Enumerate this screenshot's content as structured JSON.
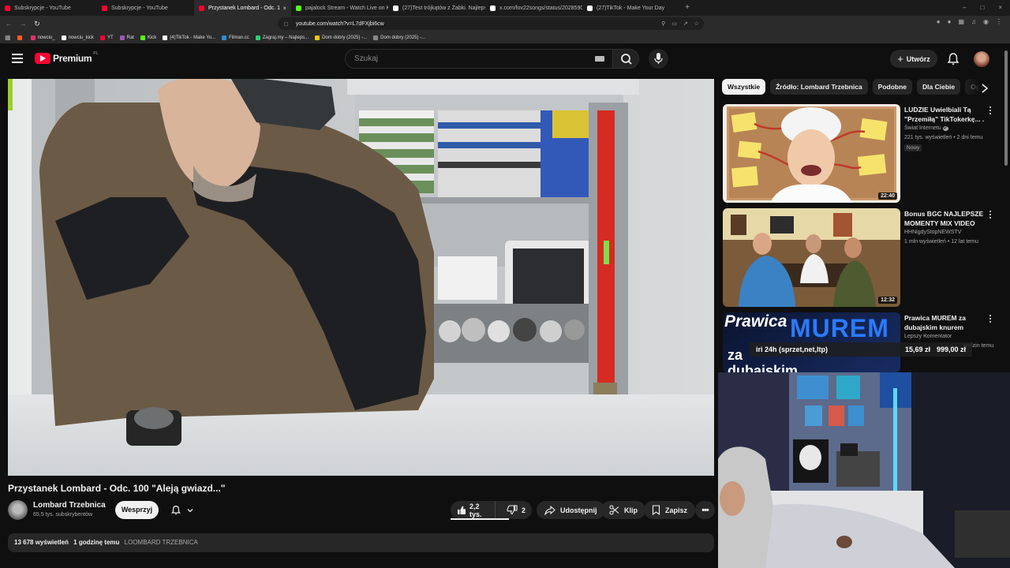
{
  "browser": {
    "tabs": [
      {
        "label": "Subskrypcje - YouTube",
        "color": "#ff0033",
        "active": false
      },
      {
        "label": "Subskrypcje - YouTube",
        "color": "#ff0033",
        "active": false
      },
      {
        "label": "Przystanek Lombard - Odc. 1",
        "color": "#ff0033",
        "active": true
      },
      {
        "label": "pajalock Stream - Watch Live on Kick",
        "color": "#53fc18",
        "active": false
      },
      {
        "label": "(27)Test trójkątów z Żabki. Najlepsz",
        "color": "#ffffff",
        "active": false
      },
      {
        "label": "x.com/fov22songs/status/20285901",
        "color": "#ffffff",
        "active": false
      },
      {
        "label": "(27)TikTok - Make Your Day",
        "color": "#ffffff",
        "active": false
      }
    ],
    "tab_close": "×",
    "new_tab": "+",
    "window_controls": [
      "–",
      "□",
      "×"
    ],
    "url": "youtube.com/watch?v=L7dFXjbi6cw",
    "bookmarks": [
      {
        "label": "",
        "color": "#ff5a1f"
      },
      {
        "label": "nowciu_",
        "color": "#e1306c"
      },
      {
        "label": "nowciu_kick",
        "color": "#ffffff"
      },
      {
        "label": "YT",
        "color": "#ff0033"
      },
      {
        "label": "Rat",
        "color": "#9b59b6"
      },
      {
        "label": "Kick",
        "color": "#53fc18"
      },
      {
        "label": "(4)TikTok - Make Yo...",
        "color": "#ffffff"
      },
      {
        "label": "Filman.cc",
        "color": "#2a8bd8"
      },
      {
        "label": "Zagraj.my – Najleps...",
        "color": "#2ecc71"
      },
      {
        "label": "Dom dobry (2025) -...",
        "color": "#f1c40f"
      },
      {
        "label": "Dom dobry (2025) -...",
        "color": "#888888"
      }
    ]
  },
  "youtube": {
    "logo_text": "Premium",
    "country_code": "PL",
    "search_placeholder": "Szukaj",
    "create_label": "Utwórz",
    "icons": {
      "menu": "hamburger-icon",
      "search": "search-icon",
      "mic": "mic-icon",
      "bell": "bell-icon"
    }
  },
  "video": {
    "title": "Przystanek Lombard - Odc. 100 \"Aleją gwiazd...\"",
    "channel": "Lombard Trzebnica",
    "subscribers": "65,5 tys. subskrybentów",
    "join_label": "Wesprzyj",
    "likes": "2,2 tys.",
    "like_ratio": 0.72,
    "dislikes": "2",
    "share_label": "Udostępnij",
    "clip_label": "Klip",
    "save_label": "Zapisz",
    "views": "13 678 wyświetleń",
    "time_ago": "1 godzinę temu",
    "hashtag": "LOOMBARD TRZEBNICA"
  },
  "sidebar": {
    "chips": [
      {
        "label": "Wszystkie",
        "selected": true
      },
      {
        "label": "Źródło: Lombard Trzebnica",
        "selected": false
      },
      {
        "label": "Podobne",
        "selected": false
      },
      {
        "label": "Dla Ciebie",
        "selected": false
      },
      {
        "label": "Oglądane",
        "selected": false
      }
    ],
    "recommendations": [
      {
        "title": "LUDZIE Uwielbiali Tą \"Przemiłą\" TikTokerkę... .",
        "channel": "Świat Internetu",
        "verified": "✔",
        "meta": "221 tys. wyświetleń • 2 dni temu",
        "badge": "Nowy",
        "duration": "22:40"
      },
      {
        "title": "Bonus BGC NAJLEPSZE MOMENTY MIX VIDEO",
        "channel": "HHNigdyStopNEWSTV",
        "meta": "1 mln wyświetleń • 12 lat temu",
        "duration": "12:32"
      },
      {
        "title": "Prawica MUREM za dubajskim knurem",
        "channel": "Lepszy Komentator",
        "meta": "godzin temu",
        "thumb_text_top": "Prawica",
        "thumb_text_big": "MUREM",
        "thumb_text_bottom": "za dubajskim"
      }
    ]
  },
  "stream_overlay": {
    "label": "iri 24h (sprzet,net,ltp)",
    "amount_now": "15,69 zł",
    "amount_goal": "999,00 zł"
  }
}
